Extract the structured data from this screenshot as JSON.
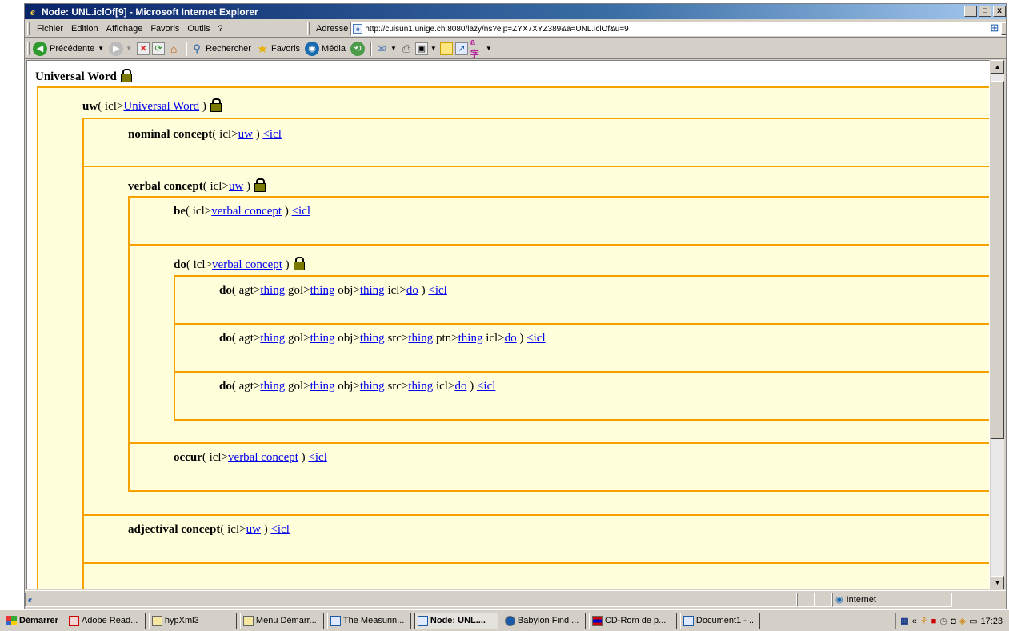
{
  "window": {
    "title": "Node: UNL.iclOf[9] - Microsoft Internet Explorer",
    "controls": [
      "_",
      "□",
      "x"
    ]
  },
  "menu": [
    "Fichier",
    "Edition",
    "Affichage",
    "Favoris",
    "Outils",
    "?"
  ],
  "address": {
    "label": "Adresse",
    "url": "http://cuisun1.unige.ch:8080/lazy/ns?eip=ZYX7XYZ389&a=UNL.iclOf&u=9",
    "go_label": "OK"
  },
  "toolbar": {
    "back": "Précédente",
    "search": "Rechercher",
    "favorites": "Favoris",
    "media": "Média"
  },
  "tree": {
    "root": "Universal Word",
    "uw": {
      "name": "uw",
      "args": "( icl>",
      "link": "Universal Word",
      "close": " )"
    },
    "nominal": {
      "name": "nominal concept",
      "args": "( icl>",
      "link": "uw",
      "close": " )",
      "back": "<icl"
    },
    "verbal": {
      "name": "verbal concept",
      "args": "( icl>",
      "link": "uw",
      "close": " )"
    },
    "be": {
      "name": "be",
      "args": "( icl>",
      "link": "verbal concept",
      "close": " )",
      "back": "<icl"
    },
    "do": {
      "name": "do",
      "args": "( icl>",
      "link": "verbal concept",
      "close": " )"
    },
    "do1": {
      "name": "do",
      "pre": "( agt>",
      "l1": "thing",
      "t1": " gol>",
      "l2": "thing",
      "t2": " obj>",
      "l3": "thing",
      "t3": " icl>",
      "l4": "do",
      "close": " )",
      "back": "<icl"
    },
    "do2": {
      "name": "do",
      "pre": "( agt>",
      "l1": "thing",
      "t1": " gol>",
      "l2": "thing",
      "t2": " obj>",
      "l3": "thing",
      "t3": " src>",
      "l4": "thing",
      "t4": " ptn>",
      "l5": "thing",
      "t5": " icl>",
      "l6": "do",
      "close": " )",
      "back": "<icl"
    },
    "do3": {
      "name": "do",
      "pre": "( agt>",
      "l1": "thing",
      "t1": " gol>",
      "l2": "thing",
      "t2": " obj>",
      "l3": "thing",
      "t3": " src>",
      "l4": "thing",
      "t4": " icl>",
      "l5": "do",
      "close": " )",
      "back": "<icl"
    },
    "occur": {
      "name": "occur",
      "args": "( icl>",
      "link": "verbal concept",
      "close": " )",
      "back": "<icl"
    },
    "adjectival": {
      "name": "adjectival concept",
      "args": "( icl>",
      "link": "uw",
      "close": " )",
      "back": "<icl"
    }
  },
  "status": {
    "zone": "Internet"
  },
  "taskbar": {
    "start": "Démarrer",
    "tasks": [
      "Adobe Read...",
      "hypXml3",
      "Menu Démarr...",
      "The Measurin...",
      "Node: UNL....",
      "Babylon Find ...",
      "CD-Rom de p...",
      "Document1 - ..."
    ],
    "clock": "17:23"
  },
  "colors": {
    "box_border": "#f5a200",
    "box_fill": "#ffffdb",
    "title_bar": "#0a246a",
    "link": "#0000ee"
  }
}
